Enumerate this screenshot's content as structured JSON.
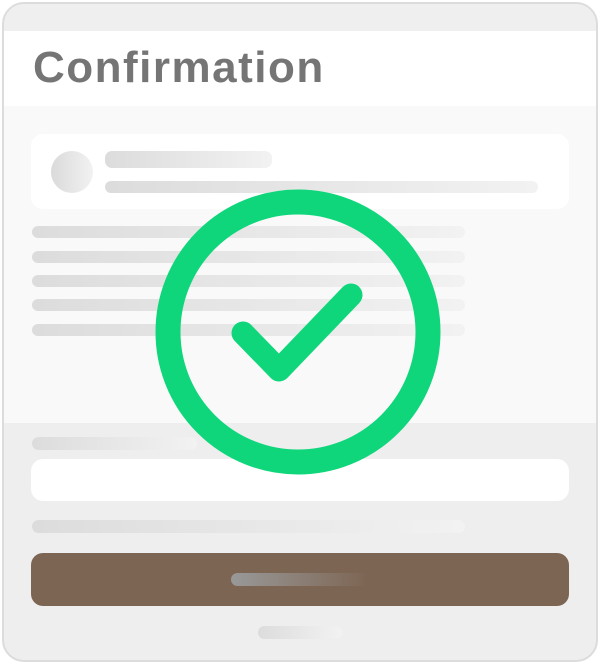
{
  "header": {
    "title": "Confirmation"
  },
  "status": {
    "icon": "check-circle-icon",
    "color": "#10d67b"
  },
  "colors": {
    "button": "#7d6553",
    "title": "#757575"
  }
}
